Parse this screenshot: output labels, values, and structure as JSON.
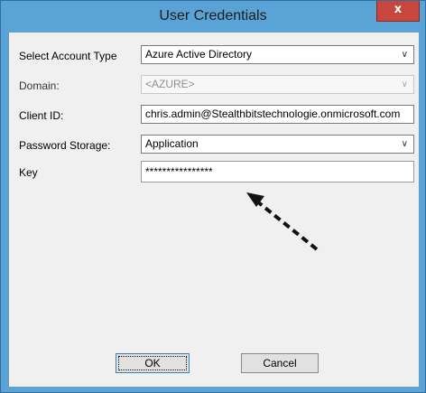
{
  "window": {
    "title": "User Credentials",
    "close_glyph": "x"
  },
  "form": {
    "account_type": {
      "label": "Select Account Type",
      "value": "Azure Active Directory"
    },
    "domain": {
      "label": "Domain:",
      "value": "<AZURE>"
    },
    "client_id": {
      "label": "Client ID:",
      "value": "chris.admin@Stealthbitstechnologie.onmicrosoft.com"
    },
    "password_storage": {
      "label": "Password Storage:",
      "value": "Application"
    },
    "key": {
      "label": "Key",
      "value": "****************"
    }
  },
  "buttons": {
    "ok": "OK",
    "cancel": "Cancel"
  },
  "icons": {
    "dropdown": "chevron-down-icon",
    "annotation": "dashed-arrow-icon"
  }
}
